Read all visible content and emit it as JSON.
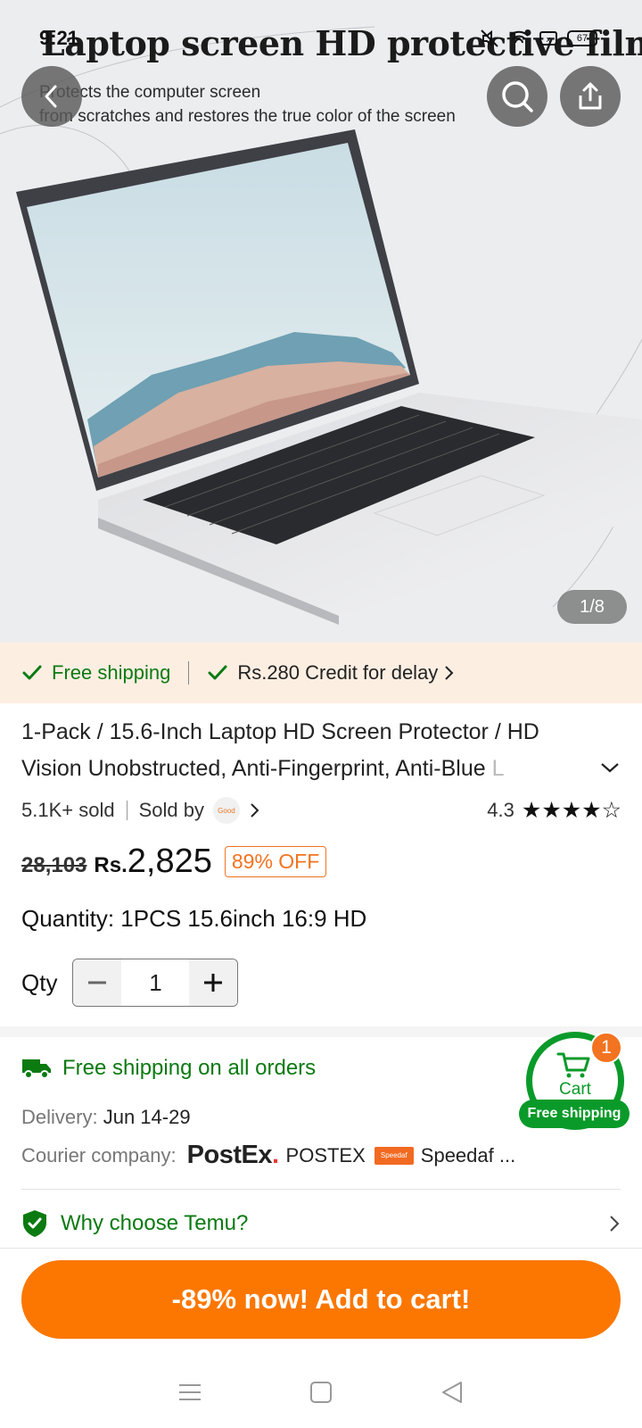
{
  "status_bar": {
    "time": "9:21",
    "battery": "67"
  },
  "hero": {
    "title": "Laptop screen HD protective film",
    "subtitle_line1": "Protects the computer screen",
    "subtitle_line2": "from scratches and restores the true color of the screen",
    "counter": "1/8"
  },
  "banner": {
    "free_shipping": "Free shipping",
    "credit": "Rs.280 Credit for delay"
  },
  "product": {
    "title_main": "1-Pack / 15.6-Inch Laptop HD Screen Protector / HD Vision Unobstructed, Anti-Fingerprint, Anti-Blue ",
    "title_fade": "L",
    "sold": "5.1K+ sold",
    "sold_by_label": "Sold by",
    "seller_logo_text": "Good",
    "rating": "4.3",
    "stars": 4.3,
    "old_price": "28,103",
    "currency": "Rs.",
    "price": "2,825",
    "discount": "89% OFF",
    "quantity_option": "Quantity: 1PCS 15.6inch 16:9 HD",
    "qty_label": "Qty",
    "qty_value": "1"
  },
  "shipping": {
    "headline": "Free shipping on all orders",
    "delivery_label": "Delivery:",
    "delivery_value": "Jun 14-29",
    "courier_label": "Courier company:",
    "courier_logo": "PostEx",
    "courier_name": "POSTEX",
    "courier2_logo": "Speedaf",
    "courier2_name": "Speedaf ..."
  },
  "cart": {
    "label": "Cart",
    "badge": "1",
    "free_shipping": "Free shipping"
  },
  "why": {
    "label": "Why choose Temu?"
  },
  "cta": {
    "label": "-89% now! Add to cart!"
  },
  "colors": {
    "accent": "#fb7701",
    "green": "#0b7a11",
    "banner_bg": "#fdeee2"
  }
}
